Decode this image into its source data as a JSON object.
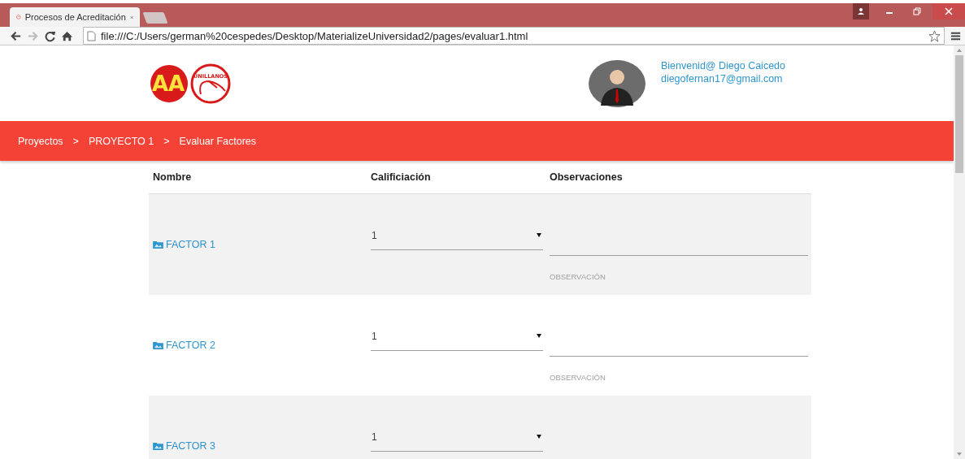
{
  "browser": {
    "tab_title": "Procesos de Acreditación",
    "url": "file:///C:/Users/german%20cespedes/Desktop/MaterializeUniversidad2/pages/evaluar1.html"
  },
  "logo": {
    "mark": "AA",
    "name": "UNILLANOS"
  },
  "user": {
    "greeting": "Bienvenid@ Diego Caicedo",
    "email": "diegofernan17@gmail.com"
  },
  "breadcrumbs": [
    {
      "label": "Proyectos"
    },
    {
      "label": "PROYECTO 1"
    },
    {
      "label": "Evaluar Factores"
    }
  ],
  "breadcrumb_separator": ">",
  "table": {
    "columns": [
      "Nombre",
      "Calificiación",
      "Observaciones"
    ],
    "rows": [
      {
        "name": "FACTOR 1",
        "rating": "1",
        "placeholder": "OBSERVACIÓN"
      },
      {
        "name": "FACTOR 2",
        "rating": "1",
        "placeholder": "OBSERVACIÓN"
      },
      {
        "name": "FACTOR 3",
        "rating": "1"
      }
    ]
  }
}
